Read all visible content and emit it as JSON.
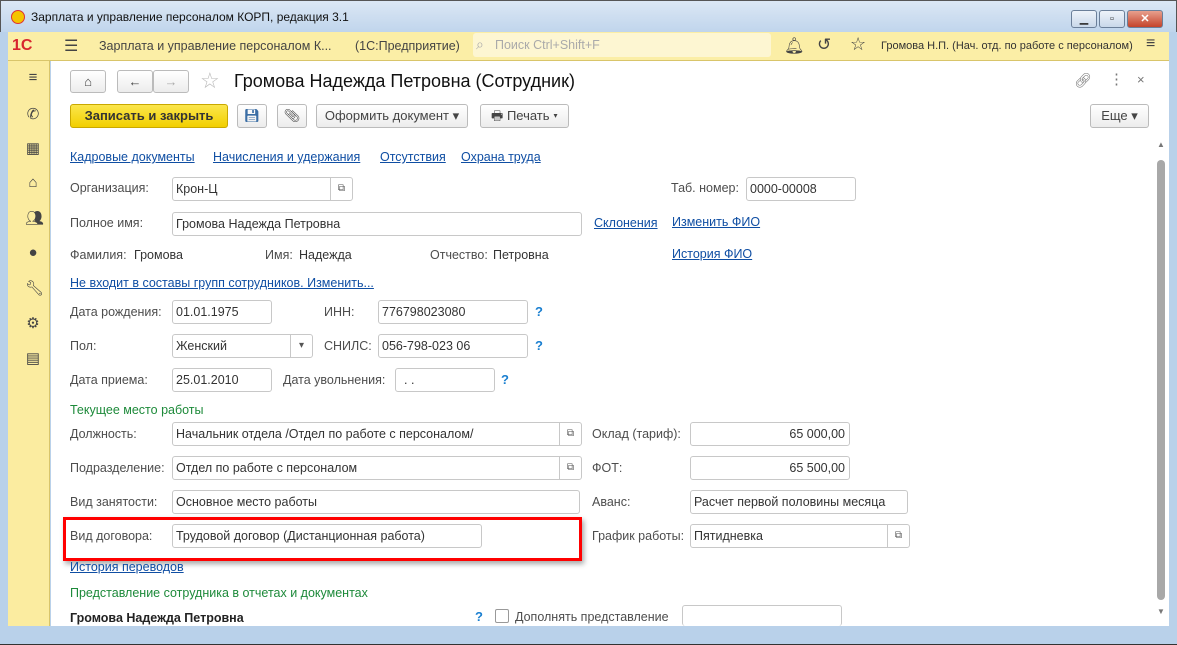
{
  "window": {
    "title": "Зарплата и управление персоналом КОРП, редакция 3.1",
    "min": "▁",
    "max": "▫",
    "close": "✕"
  },
  "appbar": {
    "logo": "1С",
    "app_name": "Зарплата и управление персоналом К...",
    "platform": "(1С:Предприятие)",
    "search_placeholder": "Поиск Ctrl+Shift+F",
    "user": "Громова Н.П. (Нач. отд. по работе с персоналом)"
  },
  "form": {
    "title": "Громова Надежда Петровна (Сотрудник)",
    "toolbar": {
      "save_close": "Записать и закрыть",
      "create_doc": "Оформить документ",
      "print": "Печать",
      "more": "Еще"
    },
    "links": [
      "Кадровые документы",
      "Начисления и удержания",
      "Отсутствия",
      "Охрана труда"
    ],
    "org_label": "Организация:",
    "org": "Крон-Ц",
    "tab_label": "Таб. номер:",
    "tab": "0000-00008",
    "fullname_label": "Полное имя:",
    "fullname": "Громова Надежда Петровна",
    "declension": "Склонения",
    "change_fio": "Изменить ФИО",
    "surname_label": "Фамилия:",
    "surname": "Громова",
    "name_label": "Имя:",
    "name": "Надежда",
    "patronymic_label": "Отчество:",
    "patronymic": "Петровна",
    "fio_history": "История ФИО",
    "groups_link": "Не входит в составы групп сотрудников. Изменить...",
    "birth_label": "Дата рождения:",
    "birth": "01.01.1975",
    "inn_label": "ИНН:",
    "inn": "776798023080",
    "sex_label": "Пол:",
    "sex": "Женский",
    "snils_label": "СНИЛС:",
    "snils": "056-798-023 06",
    "hire_label": "Дата приема:",
    "hire": "25.01.2010",
    "fire_label": "Дата увольнения:",
    "fire": " .  .",
    "q": "?",
    "current_section": "Текущее место работы",
    "position_label": "Должность:",
    "position": "Начальник отдела /Отдел по работе с персоналом/",
    "salary_label": "Оклад (тариф):",
    "salary": "65 000,00",
    "dept_label": "Подразделение:",
    "dept": "Отдел по работе с персоналом",
    "fot_label": "ФОТ:",
    "fot": "65 500,00",
    "employment_label": "Вид занятости:",
    "employment": "Основное место работы",
    "advance_label": "Аванс:",
    "advance": "Расчет первой половины месяца",
    "contract_label": "Вид договора:",
    "contract": "Трудовой договор (Дистанционная работа)",
    "schedule_label": "График работы:",
    "schedule": "Пятидневка",
    "transfers_link": "История переводов",
    "repr_section": "Представление сотрудника в отчетах и документах",
    "repr_name": "Громова Надежда Петровна",
    "supplement_label": "Дополнять представление",
    "supplement": ""
  },
  "colors": {
    "highlight": "#ff0000",
    "accent_yellow": "#f5d800",
    "link": "#0f4ea3",
    "section": "#1d8a3a"
  }
}
